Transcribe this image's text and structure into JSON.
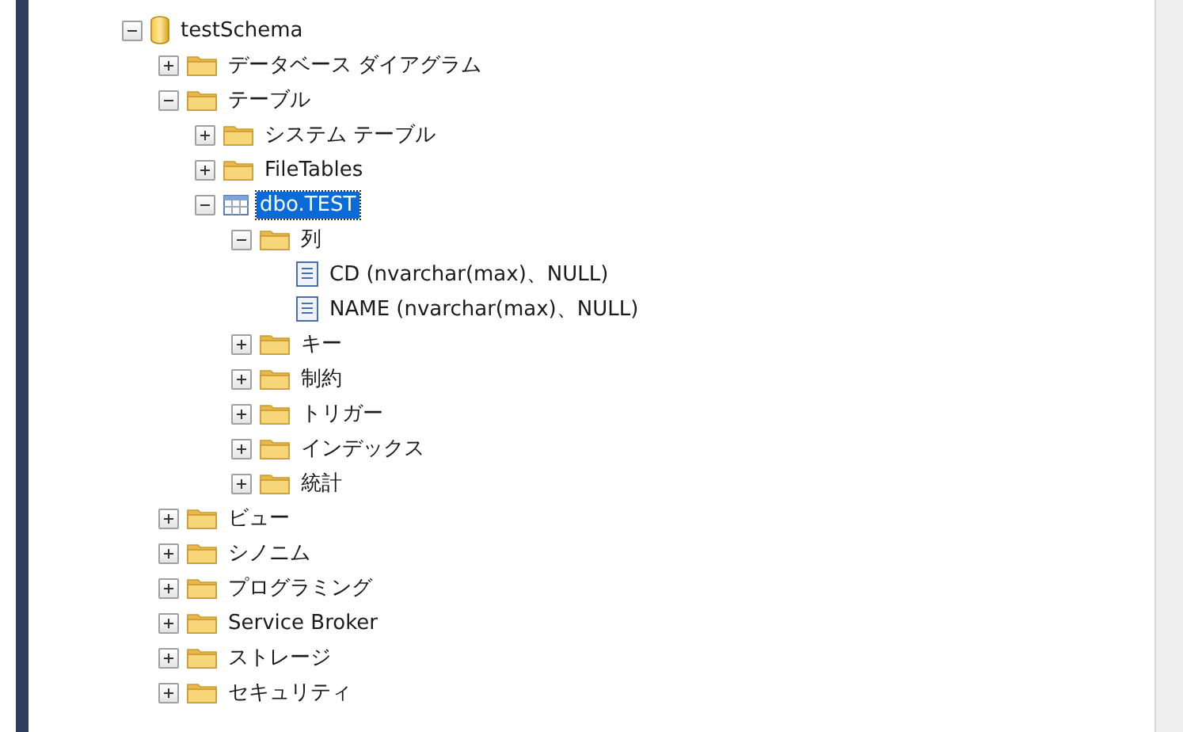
{
  "tree": [
    {
      "label": "testSchema",
      "kind": "database",
      "expanded": true,
      "selected": false,
      "children": [
        {
          "label": "データベース ダイアグラム",
          "kind": "folder",
          "expanded": false,
          "selected": false
        },
        {
          "label": "テーブル",
          "kind": "folder",
          "expanded": true,
          "selected": false,
          "children": [
            {
              "label": "システム テーブル",
              "kind": "folder",
              "expanded": false,
              "selected": false
            },
            {
              "label": "FileTables",
              "kind": "folder",
              "expanded": false,
              "selected": false
            },
            {
              "label": "dbo.TEST",
              "kind": "table",
              "expanded": true,
              "selected": true,
              "children": [
                {
                  "label": "列",
                  "kind": "folder",
                  "expanded": true,
                  "selected": false,
                  "children": [
                    {
                      "label": "CD (nvarchar(max)、NULL)",
                      "kind": "column",
                      "selected": false
                    },
                    {
                      "label": "NAME (nvarchar(max)、NULL)",
                      "kind": "column",
                      "selected": false
                    }
                  ]
                },
                {
                  "label": "キー",
                  "kind": "folder",
                  "expanded": false,
                  "selected": false
                },
                {
                  "label": "制約",
                  "kind": "folder",
                  "expanded": false,
                  "selected": false
                },
                {
                  "label": "トリガー",
                  "kind": "folder",
                  "expanded": false,
                  "selected": false
                },
                {
                  "label": "インデックス",
                  "kind": "folder",
                  "expanded": false,
                  "selected": false
                },
                {
                  "label": "統計",
                  "kind": "folder",
                  "expanded": false,
                  "selected": false
                }
              ]
            }
          ]
        },
        {
          "label": "ビュー",
          "kind": "folder",
          "expanded": false,
          "selected": false
        },
        {
          "label": "シノニム",
          "kind": "folder",
          "expanded": false,
          "selected": false
        },
        {
          "label": "プログラミング",
          "kind": "folder",
          "expanded": false,
          "selected": false
        },
        {
          "label": "Service Broker",
          "kind": "folder",
          "expanded": false,
          "selected": false
        },
        {
          "label": "ストレージ",
          "kind": "folder",
          "expanded": false,
          "selected": false
        },
        {
          "label": "セキュリティ",
          "kind": "folder",
          "expanded": false,
          "selected": false
        }
      ]
    }
  ]
}
